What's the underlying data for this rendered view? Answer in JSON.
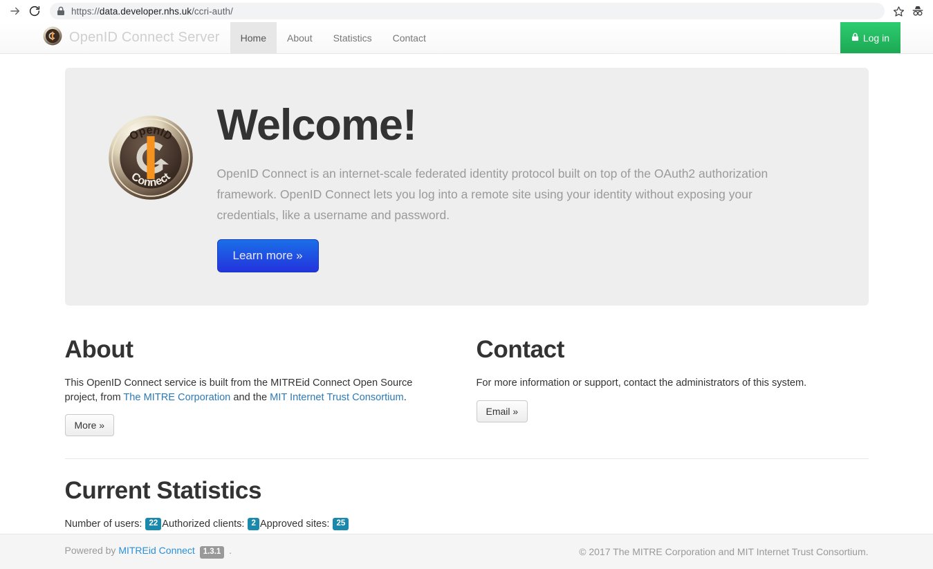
{
  "browser": {
    "url_prefix": "https://",
    "url_host": "data.developer.nhs.uk",
    "url_path": "/ccri-auth/",
    "forward_icon": "forward-arrow-icon",
    "reload_icon": "reload-icon",
    "lock_icon": "lock-icon",
    "bookmark_icon": "star-icon",
    "incognito_icon": "incognito-icon"
  },
  "navbar": {
    "brand": "OpenID Connect Server",
    "brand_logo": "openid-connect-logo",
    "links": [
      {
        "label": "Home",
        "active": true
      },
      {
        "label": "About",
        "active": false
      },
      {
        "label": "Statistics",
        "active": false
      },
      {
        "label": "Contact",
        "active": false
      }
    ],
    "login_label": "Log in",
    "login_icon": "lock-icon",
    "login_color": "#26b75f"
  },
  "jumbotron": {
    "logo": "openid-connect-logo",
    "title": "Welcome!",
    "paragraph": "OpenID Connect is an internet-scale federated identity protocol built on top of the OAuth2 authorization framework. OpenID Connect lets you log into a remote site using your identity without exposing your credentials, like a username and password.",
    "cta_label": "Learn more »",
    "cta_color": "#2038dc"
  },
  "about": {
    "title": "About",
    "text_1": "This OpenID Connect service is built from the MITREid Connect Open Source project, from ",
    "link_1": "The MITRE Corporation",
    "text_2": " and the ",
    "link_2": "MIT Internet Trust Consortium",
    "text_3": ".",
    "button_label": "More »"
  },
  "contact": {
    "title": "Contact",
    "text": "For more information or support, contact the administrators of this system.",
    "button_label": "Email »"
  },
  "statistics": {
    "title": "Current Statistics",
    "users_label": "Number of users:",
    "users_count": "22",
    "clients_label": "Authorized clients:",
    "clients_count": "2",
    "sites_label": "Approved sites:",
    "sites_count": "25",
    "badge_color": "#1b89ac"
  },
  "footer": {
    "powered_by": "Powered by",
    "product_link": "MITREid Connect",
    "version": "1.3.1",
    "period": ".",
    "copyright": "© 2017 The MITRE Corporation and MIT Internet Trust Consortium."
  }
}
